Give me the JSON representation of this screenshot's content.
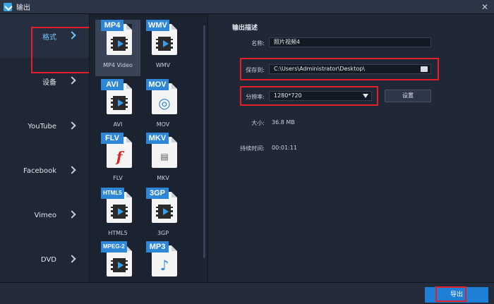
{
  "window": {
    "title": "输出",
    "close_glyph": "✕"
  },
  "categories": [
    {
      "label": "格式",
      "active": true
    },
    {
      "label": "设备"
    },
    {
      "label": "YouTube"
    },
    {
      "label": "Facebook"
    },
    {
      "label": "Vimeo"
    },
    {
      "label": "DVD"
    }
  ],
  "formats": [
    {
      "badge": "MP4",
      "label": "MP4 Video",
      "selected": true,
      "icon": "film-icon"
    },
    {
      "badge": "WMV",
      "label": "WMV",
      "icon": "film-icon"
    },
    {
      "badge": "AVI",
      "label": "AVI",
      "icon": "film-icon"
    },
    {
      "badge": "MOV",
      "label": "MOV",
      "icon": "quicktime-icon"
    },
    {
      "badge": "FLV",
      "label": "FLV",
      "icon": "flash-icon"
    },
    {
      "badge": "MKV",
      "label": "MKV",
      "icon": "matroska-icon"
    },
    {
      "badge": "HTML5",
      "label": "HTML5",
      "icon": "film-icon"
    },
    {
      "badge": "3GP",
      "label": "3GP",
      "icon": "film-icon"
    },
    {
      "badge": "MPEG-2",
      "label": "",
      "icon": "film-icon"
    },
    {
      "badge": "MP3",
      "label": "",
      "icon": "music-note-icon"
    }
  ],
  "details": {
    "section_title": "输出描述",
    "name_label": "名称:",
    "name_value": "照片视频4",
    "save_label": "保存到:",
    "save_path": "C:\\Users\\Administrator\\Desktop\\",
    "resolution_label": "分辨率:",
    "resolution_value": "1280*720",
    "settings_button": "设置",
    "size_label": "大小:",
    "size_value": "36.8 MB",
    "duration_label": "持续时间:",
    "duration_value": "00:01:11"
  },
  "footer": {
    "export_button": "导出"
  },
  "colors": {
    "accent": "#1e7fd6",
    "highlight": "#e3202a",
    "active_text": "#6fc6ff"
  }
}
